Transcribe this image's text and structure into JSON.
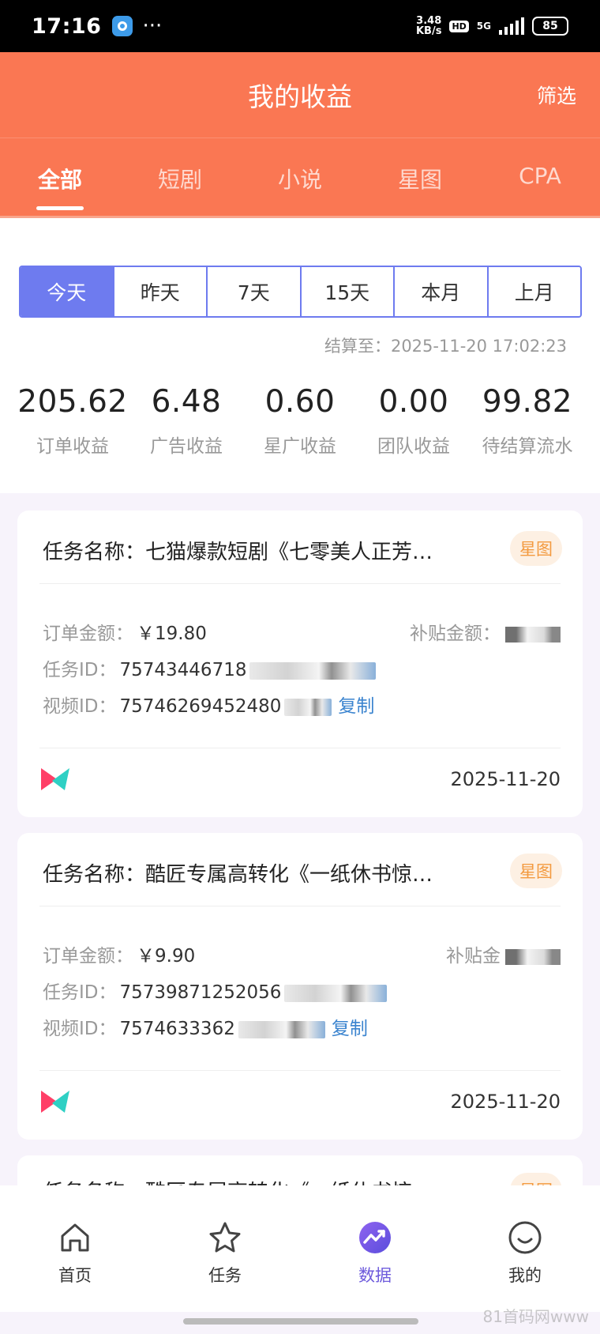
{
  "status_bar": {
    "time": "17:16",
    "dots": "···",
    "net_speed_value": "3.48",
    "net_speed_unit": "KB/s",
    "hd": "HD",
    "net_type": "5G",
    "battery": "85"
  },
  "header": {
    "title": "我的收益",
    "filter_label": "筛选",
    "tabs": [
      "全部",
      "短剧",
      "小说",
      "星图",
      "CPA"
    ],
    "active_tab": "全部"
  },
  "periods": {
    "options": [
      "今天",
      "昨天",
      "7天",
      "15天",
      "本月",
      "上月"
    ],
    "active": "今天"
  },
  "settle_time": "结算至：2025-11-20 17:02:23",
  "stats": [
    {
      "value": "205.62",
      "label": "订单收益"
    },
    {
      "value": "6.48",
      "label": "广告收益"
    },
    {
      "value": "0.60",
      "label": "星广收益"
    },
    {
      "value": "0.00",
      "label": "团队收益"
    },
    {
      "value": "99.82",
      "label": "待结算流水"
    }
  ],
  "cards": [
    {
      "title": "任务名称：七猫爆款短剧《七零美人正芳…",
      "tag": "星图",
      "order_amount_label": "订单金额：",
      "order_amount": "￥19.80",
      "subsidy_label": "补贴金额：",
      "task_id_label": "任务ID：",
      "task_id": "75743446718",
      "video_id_label": "视频ID：",
      "video_id": "75746269452480",
      "copy_label": "复制",
      "date": "2025-11-20"
    },
    {
      "title": "任务名称：酷匠专属高转化《一纸休书惊…",
      "tag": "星图",
      "order_amount_label": "订单金额：",
      "order_amount": "￥9.90",
      "subsidy_label": "补贴金",
      "task_id_label": "任务ID：",
      "task_id": "75739871252056",
      "video_id_label": "视频ID：",
      "video_id": "7574633362",
      "copy_label": "复制",
      "date": "2025-11-20"
    }
  ],
  "partial_card_title": "任务名称：酷匠专属高转化《一纸休书惊",
  "bottom_nav": [
    {
      "label": "首页",
      "icon": "home-icon"
    },
    {
      "label": "任务",
      "icon": "star-icon"
    },
    {
      "label": "数据",
      "icon": "chart-icon"
    },
    {
      "label": "我的",
      "icon": "smile-icon"
    }
  ],
  "active_nav": "数据",
  "watermark": "81首码网www",
  "colors": {
    "header_bg": "#fa7753",
    "segment_active": "#6e7bef",
    "tag_bg": "#fdf0e3",
    "tag_text": "#f39a3f",
    "copy_link": "#3b84cf",
    "nav_active": "#6e5bdc"
  }
}
